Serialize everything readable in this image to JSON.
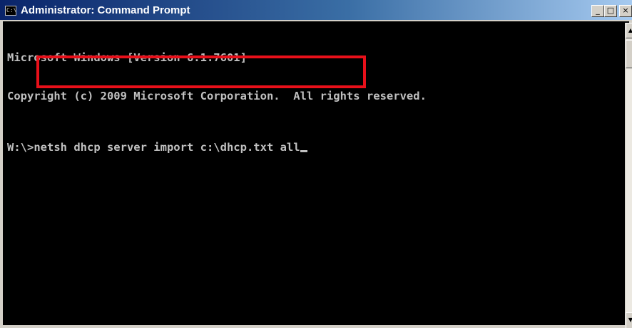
{
  "window": {
    "title": "Administrator: Command Prompt",
    "icon": "cmd-icon",
    "icon_glyph": "C:\\",
    "controls": {
      "minimize_glyph": "_",
      "maximize_glyph": "□",
      "close_glyph": "×"
    }
  },
  "console": {
    "lines": [
      "Microsoft Windows [Version 6.1.7601]",
      "Copyright (c) 2009 Microsoft Corporation.  All rights reserved."
    ],
    "prompt": "W:\\>",
    "command": "netsh dhcp server import c:\\dhcp.txt all"
  },
  "annotation": {
    "color": "#e8101a",
    "target": "console-command"
  },
  "scrollbar": {
    "up_glyph": "▲",
    "down_glyph": "▼"
  },
  "colors": {
    "console_background": "#000000",
    "console_text": "#c0c0c0",
    "titlebar_start": "#0a246a",
    "titlebar_end": "#a6caf0",
    "highlight": "#e8101a"
  }
}
